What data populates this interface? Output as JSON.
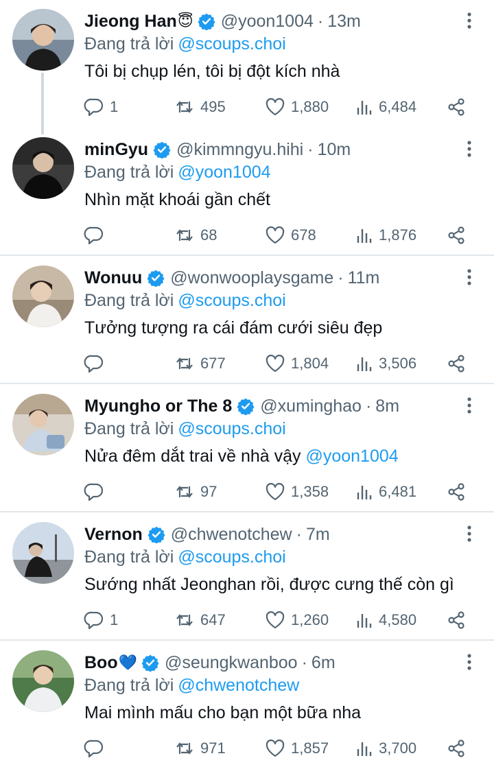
{
  "reply_prefix": "Đang trả lời",
  "colors": {
    "accent": "#1d9bf0",
    "secondary": "#536471",
    "divider": "#e1e6ea"
  },
  "tweets": [
    {
      "name": "Jieong Han",
      "emoji": "😇",
      "handle": "@yoon1004",
      "time": "13m",
      "reply_to": "@scoups.choi",
      "text": "Tôi bị chụp lén, tôi bị đột kích nhà",
      "text_mention": "",
      "replies": "1",
      "retweets": "495",
      "likes": "1,880",
      "views": "6,484"
    },
    {
      "name": "minGyu",
      "emoji": "",
      "handle": "@kimmngyu.hihi",
      "time": "10m",
      "reply_to": "@yoon1004",
      "text": "Nhìn mặt khoái gần chết",
      "text_mention": "",
      "replies": "",
      "retweets": "68",
      "likes": "678",
      "views": "1,876"
    },
    {
      "name": "Wonuu",
      "emoji": "",
      "handle": "@wonwooplaysgame",
      "time": "11m",
      "reply_to": "@scoups.choi",
      "text": "Tưởng tượng ra cái đám cưới siêu đẹp",
      "text_mention": "",
      "replies": "",
      "retweets": "677",
      "likes": "1,804",
      "views": "3,506"
    },
    {
      "name": "Myungho or The 8",
      "emoji": "",
      "handle": "@xuminghao",
      "time": "8m",
      "reply_to": "@scoups.choi",
      "text": "Nửa đêm dắt trai về nhà vậy ",
      "text_mention": "@yoon1004",
      "replies": "",
      "retweets": "97",
      "likes": "1,358",
      "views": "6,481"
    },
    {
      "name": "Vernon",
      "emoji": "",
      "handle": "@chwenotchew",
      "time": "7m",
      "reply_to": "@scoups.choi",
      "text": "Sướng nhất Jeonghan rồi, được cưng thế còn gì",
      "text_mention": "",
      "replies": "1",
      "retweets": "647",
      "likes": "1,260",
      "views": "4,580"
    },
    {
      "name": "Boo",
      "emoji": "💙",
      "handle": "@seungkwanboo",
      "time": "6m",
      "reply_to": "@chwenotchew",
      "text": "Mai mình mấu cho bạn một bữa nha",
      "text_mention": "",
      "replies": "",
      "retweets": "971",
      "likes": "1,857",
      "views": "3,700"
    }
  ]
}
